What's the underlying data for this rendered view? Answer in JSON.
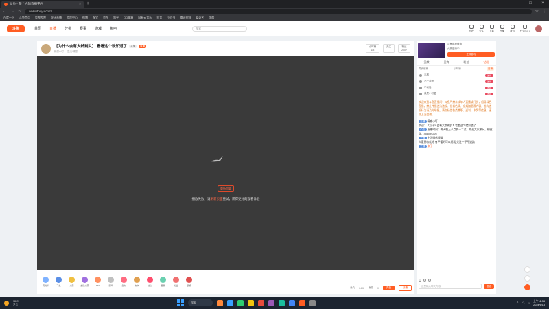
{
  "browser": {
    "tab_title": "斗鱼 - 每个人的直播平台",
    "url": "www.douyu.com/...",
    "bookmarks": [
      "百度一下",
      "斗鱼首页",
      "哔哩哔哩",
      "虎牙直播",
      "游戏中心",
      "微博",
      "淘宝",
      "京东",
      "知乎",
      "QQ邮箱",
      "网易云音乐",
      "抖音",
      "小红书",
      "腾讯视频",
      "爱奇艺",
      "优酷"
    ]
  },
  "site": {
    "logo": "斗鱼",
    "nav": [
      "首页",
      "直播",
      "分类",
      "赛事",
      "游戏",
      "鱼吧"
    ],
    "search_placeholder": "搜索",
    "header_icons": [
      "历史",
      "关注",
      "下载",
      "开播",
      "背包",
      "任务中心"
    ]
  },
  "room": {
    "title": "【为什么会有大龄剩女】 看看这个就知道了",
    "tag_grey": "主播",
    "tag_orange": "直播",
    "host": "情感小叮",
    "category": "生活/情感",
    "rank_label": "小时榜",
    "rank_value": "1/3",
    "follow_label": "关注",
    "fans_label": "粉丝",
    "fans_value": "200+"
  },
  "player": {
    "error_button": "重新加载",
    "error_text_pre": "播放失败，请",
    "error_text_link": "刷新页面",
    "error_text_post": "重试，获得更好的观看体验"
  },
  "gifts": [
    {
      "label": "荧光棒",
      "color": "#7fb2ff"
    },
    {
      "label": "飞机",
      "color": "#5b8fe6"
    },
    {
      "label": "火箭",
      "color": "#f0c040"
    },
    {
      "label": "超级火箭",
      "color": "#a070e0"
    },
    {
      "label": "666",
      "color": "#ff9060"
    },
    {
      "label": "弱鸡",
      "color": "#c0c0c0"
    },
    {
      "label": "鱼丸",
      "color": "#ff6b81"
    },
    {
      "label": "办卡",
      "color": "#e0a050"
    },
    {
      "label": "比心",
      "color": "#ff4d6d"
    },
    {
      "label": "星辰",
      "color": "#6ad0b0"
    },
    {
      "label": "礼盒",
      "color": "#f07070"
    },
    {
      "label": "贵族",
      "color": "#e05050"
    }
  ],
  "giftbar_right": {
    "balance_label": "鱼丸",
    "balance_value": "2492",
    "coins_label": "鱼翅",
    "coins_value": "0",
    "recharge": "充值",
    "noble": "开通"
  },
  "side": {
    "promo_title": "斗鱼年度盛典",
    "promo_sub": "火热进行中",
    "promo_btn": "立即参与",
    "tabs": [
      "贡献",
      "贵宾",
      "粉丝",
      "钻粉"
    ],
    "filter_left": "周贡献榜",
    "filter_mid": "小时榜",
    "filter_right": "日榜",
    "ranks": [
      {
        "name": "手机",
        "pill": "送礼"
      },
      {
        "name": "不于游戏",
        "pill": "送礼"
      },
      {
        "name": "不以后",
        "pill": "送礼"
      },
      {
        "name": "我是小可爱",
        "pill": "送礼"
      }
    ],
    "notice": "欢迎来到斗鱼直播间！斗鱼严禁未成年人直播或打赏，倡导绿色直播，禁止传播违法违规、低俗色情、吸烟酗酒等内容，若有违规行为请及时举报。请勿轻信各类兼职、返利、中奖等信息，谨防上当受骗。",
    "chat": [
      {
        "user": "主播",
        "text": "情感小叮"
      },
      {
        "user": "欢迎",
        "text": "【为什么会有大龄剩女】看看这个就知道了"
      },
      {
        "user": "公告",
        "text": "直播时间：每天晚上八点到十二点，欢迎大家来玩，粉丝群：458099226"
      },
      {
        "user": "主播",
        "text": "生活情感频道"
      },
      {
        "user": "",
        "text": "大家开心就好 有不懂的可以问我 关注一下不迷路"
      },
      {
        "user": "主播",
        "text": "来了"
      }
    ],
    "chat_placeholder": "这里输入聊天内容",
    "send": "发送"
  },
  "taskbar": {
    "temp": "18°C",
    "weather": "多云",
    "search": "搜索",
    "time": "上午11:34",
    "date": "2024/6/15"
  }
}
